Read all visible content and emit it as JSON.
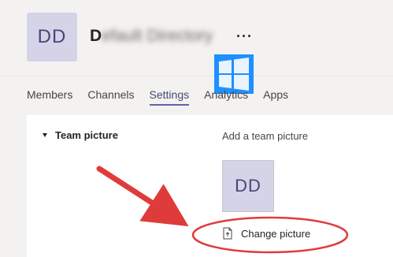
{
  "header": {
    "avatar_initials": "DD",
    "team_initial": "D",
    "team_name_obscured": "efault Directory",
    "more_label": "···"
  },
  "tabs": [
    {
      "label": "Members",
      "active": false
    },
    {
      "label": "Channels",
      "active": false
    },
    {
      "label": "Settings",
      "active": true
    },
    {
      "label": "Analytics",
      "active": false
    },
    {
      "label": "Apps",
      "active": false
    }
  ],
  "settings": {
    "section_title": "Team picture",
    "add_label": "Add a team picture",
    "picture_initials": "DD",
    "change_button_label": "Change picture"
  },
  "colors": {
    "accent": "#6264a7",
    "avatar_bg": "#d4d3e8",
    "annotation_red": "#e03b3b",
    "windows_blue": "#1e90ff"
  },
  "icons": {
    "more": "ellipsis-icon",
    "collapse": "caret-down-icon",
    "change": "image-upload-icon",
    "logo": "windows-logo-icon"
  }
}
